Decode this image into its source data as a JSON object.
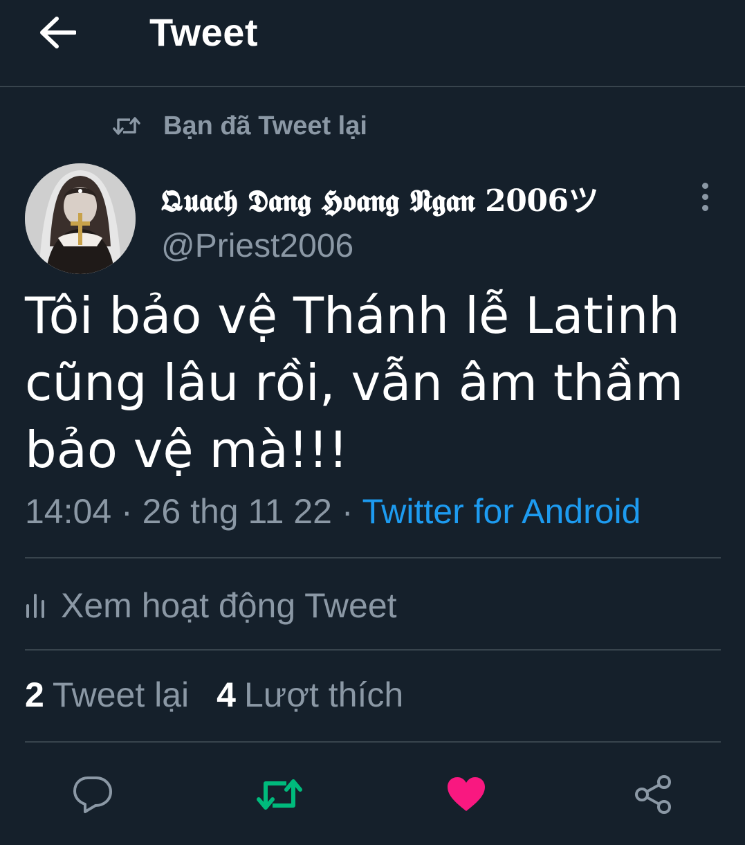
{
  "header": {
    "title": "Tweet"
  },
  "social_context": {
    "label": "Bạn đã Tweet lại"
  },
  "author": {
    "display_name": "𝕼𝖚𝖆𝖈𝖍 𝕯𝖆𝖓𝖌 𝕳𝖔𝖆𝖓𝖌 𝕹𝖌𝖆𝖓 𝟐𝟎𝟎𝟔ツ",
    "username": "@Priest2006"
  },
  "tweet": {
    "text": "Tôi bảo vệ Thánh lễ Latinh cũng lâu rồi, vẫn âm thầm bảo vệ mà!!!",
    "time": "14:04",
    "separator": "·",
    "date": "26 thg 11 22",
    "source": "Twitter for Android"
  },
  "activity": {
    "label": "Xem hoạt động Tweet"
  },
  "stats": {
    "retweets_count": "2",
    "retweets_label": "Tweet lại",
    "likes_count": "4",
    "likes_label": "Lượt thích"
  },
  "colors": {
    "background": "#15202b",
    "divider": "#38444d",
    "secondary_text": "#8b98a5",
    "link": "#1d9bf0",
    "retweet_active": "#00ba7c",
    "like_active": "#f91880"
  },
  "icons": {
    "back": "arrow-left-icon",
    "retweet_context": "retweet-icon",
    "more": "more-vertical-icon",
    "activity": "bar-chart-icon",
    "reply": "reply-icon",
    "retweet": "retweet-icon",
    "like": "heart-icon",
    "share": "share-icon"
  }
}
